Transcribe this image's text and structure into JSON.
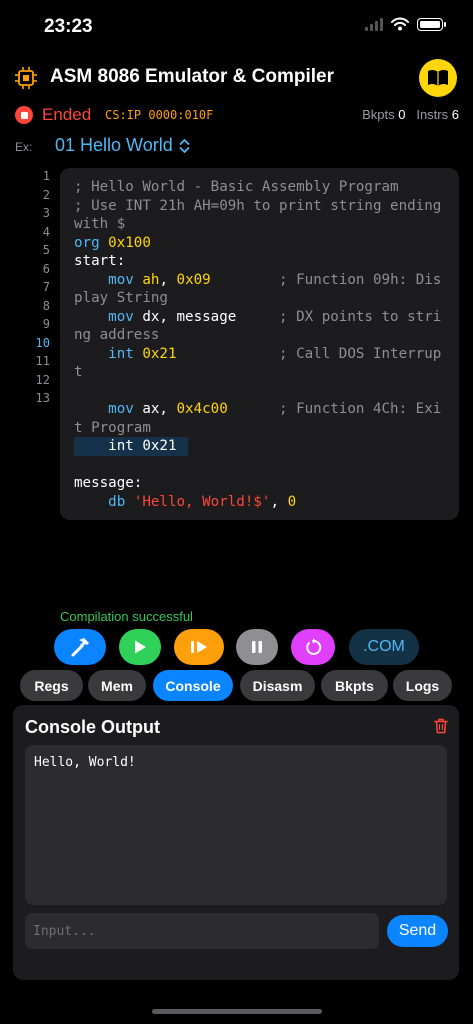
{
  "status_bar": {
    "time": "23:23"
  },
  "header": {
    "title": "ASM 8086 Emulator & Compiler"
  },
  "run_status": {
    "state": "Ended",
    "csip": "CS:IP 0000:010F",
    "breakpoints_label": "Bkpts",
    "breakpoints": "0",
    "instructions_label": "Instrs",
    "instructions": "6"
  },
  "example": {
    "label": "Ex:",
    "selected": "01 Hello World"
  },
  "editor": {
    "line_numbers": [
      "1",
      "2",
      "3",
      "4",
      "5",
      "6",
      "7",
      "8",
      "9",
      "10",
      "11",
      "12",
      "13"
    ],
    "active_line": "10",
    "code": [
      {
        "t": "; Hello World - Basic Assembly Program",
        "c": "com"
      },
      {
        "t": "\n",
        "c": ""
      },
      {
        "t": "; Use INT 21h AH=09h to print string ending with $",
        "c": "com"
      },
      {
        "t": "\n",
        "c": ""
      },
      {
        "t": "org ",
        "c": "kw"
      },
      {
        "t": "0x100",
        "c": "num"
      },
      {
        "t": "\n",
        "c": ""
      },
      {
        "t": "start:",
        "c": ""
      },
      {
        "t": "\n",
        "c": ""
      },
      {
        "t": "    mov ",
        "c": "kw"
      },
      {
        "t": "ah",
        "c": "num"
      },
      {
        "t": ", ",
        "c": ""
      },
      {
        "t": "0x09",
        "c": "num"
      },
      {
        "t": "        ; Function 09h: Display String",
        "c": "com"
      },
      {
        "t": "\n",
        "c": ""
      },
      {
        "t": "    mov ",
        "c": "kw"
      },
      {
        "t": "dx, message",
        "c": ""
      },
      {
        "t": "     ; DX points to string address",
        "c": "com"
      },
      {
        "t": "\n",
        "c": ""
      },
      {
        "t": "    int ",
        "c": "kw"
      },
      {
        "t": "0x21",
        "c": "num"
      },
      {
        "t": "            ; Call DOS Interrupt",
        "c": "com"
      },
      {
        "t": "\n\n",
        "c": ""
      },
      {
        "t": "    mov ",
        "c": "kw"
      },
      {
        "t": "ax, ",
        "c": ""
      },
      {
        "t": "0x4c00",
        "c": "num"
      },
      {
        "t": "      ; Function 4Ch: Exit Program",
        "c": "com"
      },
      {
        "t": "\n",
        "c": ""
      },
      {
        "t": "    int 0x21",
        "c": "hl"
      },
      {
        "t": "\n\n",
        "c": ""
      },
      {
        "t": "message:",
        "c": ""
      },
      {
        "t": "\n",
        "c": ""
      },
      {
        "t": "    db ",
        "c": "kw"
      },
      {
        "t": "'Hello, World!$'",
        "c": "str"
      },
      {
        "t": ", ",
        "c": ""
      },
      {
        "t": "0",
        "c": "num"
      }
    ]
  },
  "compile_message": "Compilation successful",
  "toolbar": {
    "com_label": ".COM",
    "colors": {
      "compile": "#0a84ff",
      "run": "#30d158",
      "step": "#ff9f0a",
      "pause": "#8e8e93",
      "reset": "#e040fb",
      "com": "#143246"
    }
  },
  "tabs": [
    "Regs",
    "Mem",
    "Console",
    "Disasm",
    "Bkpts",
    "Logs"
  ],
  "active_tab": "Console",
  "console": {
    "title": "Console Output",
    "output": "Hello, World!",
    "input_value": "",
    "input_placeholder": "Input...",
    "send_label": "Send"
  }
}
